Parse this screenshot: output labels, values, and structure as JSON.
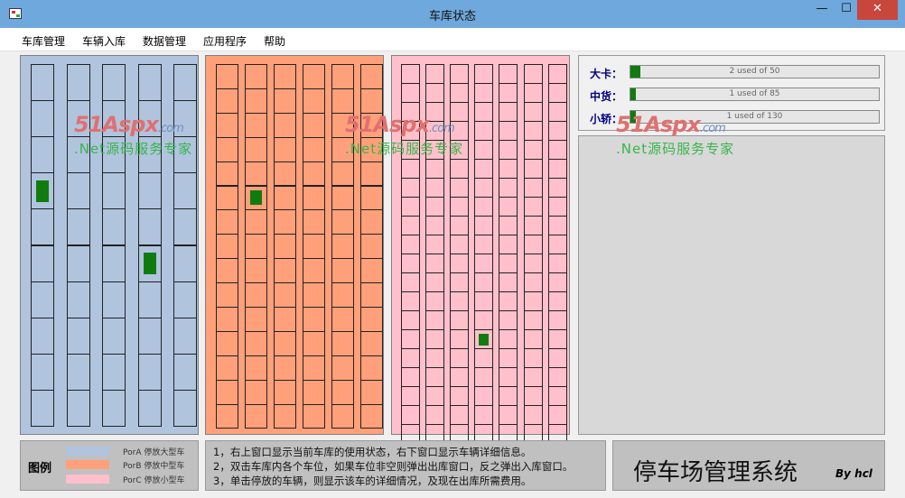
{
  "window": {
    "title": "车库状态",
    "min_glyph": "—",
    "max_glyph": "☐",
    "close_glyph": "✕"
  },
  "menu": [
    "车库管理",
    "车辆入库",
    "数据管理",
    "应用程序",
    "帮助"
  ],
  "garages": [
    {
      "name": "PorA",
      "color": "#b0c4de",
      "columns": 6,
      "rows": 10,
      "occupied": [
        [
          0,
          3
        ],
        [
          3,
          5
        ]
      ]
    },
    {
      "name": "PorB",
      "color": "#ffa07a",
      "columns": 6,
      "rows": 15,
      "occupied": [
        [
          1,
          5
        ]
      ]
    },
    {
      "name": "PorC",
      "color": "#ffc0cb",
      "columns": 7,
      "rows": 20,
      "occupied": [
        [
          3,
          14
        ]
      ]
    }
  ],
  "stats": [
    {
      "label": "大卡：",
      "text": "2 used of 50",
      "used": 2,
      "total": 50
    },
    {
      "label": "中货：",
      "text": "1 used of 85",
      "used": 1,
      "total": 85
    },
    {
      "label": "小轿：",
      "text": "1 used of 130",
      "used": 1,
      "total": 130
    }
  ],
  "watermark": {
    "logo": "51Aspx",
    "logo_suffix": ".com",
    "tagline": ".Net源码服务专家"
  },
  "legend": {
    "title": "图例",
    "items": [
      {
        "color": "#b0c4de",
        "label": "PorA 停放大型车"
      },
      {
        "color": "#ffa07a",
        "label": "PorB 停放中型车"
      },
      {
        "color": "#ffc0cb",
        "label": "PorC 停放小型车"
      }
    ]
  },
  "help": [
    "1，右上窗口显示当前车库的使用状态，右下窗口显示车辆详细信息。",
    "2，双击车库内各个车位，如果车位非空则弹出出库窗口，反之弹出入库窗口。",
    "3，单击停放的车辆，则显示该车的详细情况，及现在出库所需费用。"
  ],
  "brand": {
    "title": "停车场管理系统",
    "by": "By hcl"
  }
}
